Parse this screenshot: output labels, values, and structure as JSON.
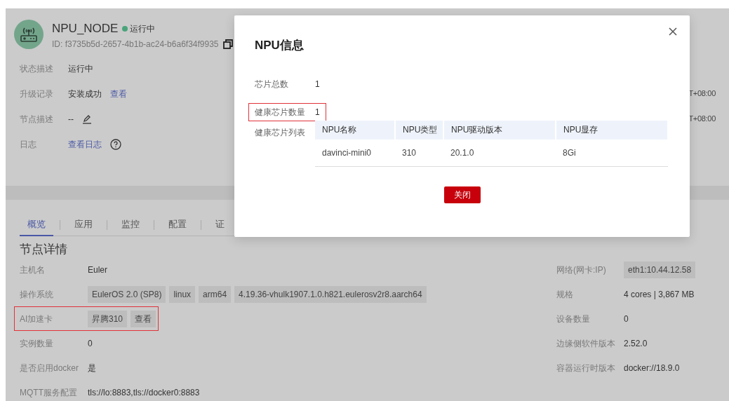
{
  "node": {
    "name": "NPU_NODE",
    "status": "运行中",
    "id": "ID: f3735b5d-2657-4b1b-ac24-b6a6f34f9935"
  },
  "info_rows": [
    {
      "label": "状态描述",
      "values": [
        {
          "kind": "text",
          "text": "运行中"
        }
      ]
    },
    {
      "label": "升级记录",
      "values": [
        {
          "kind": "text",
          "text": "安装成功"
        },
        {
          "kind": "link",
          "text": "查看"
        }
      ],
      "time": "T+08:00"
    },
    {
      "label": "节点描述",
      "values": [
        {
          "kind": "text",
          "text": "--"
        },
        {
          "kind": "edit"
        }
      ],
      "time": "T+08:00"
    },
    {
      "label": "日志",
      "values": [
        {
          "kind": "link",
          "text": "查看日志"
        },
        {
          "kind": "help"
        }
      ]
    }
  ],
  "tabs": [
    {
      "label": "概览",
      "selected": true
    },
    {
      "label": "应用",
      "selected": false
    },
    {
      "label": "监控",
      "selected": false
    },
    {
      "label": "配置",
      "selected": false
    },
    {
      "label": "证",
      "selected": false
    }
  ],
  "section_title": "节点详情",
  "details_left": [
    {
      "label": "主机名",
      "highlighted": false,
      "values": [
        {
          "kind": "text",
          "text": "Euler"
        }
      ]
    },
    {
      "label": "操作系统",
      "highlighted": false,
      "values": [
        {
          "kind": "tag",
          "text": "EulerOS 2.0 (SP8)"
        },
        {
          "kind": "tag",
          "text": "linux"
        },
        {
          "kind": "tag",
          "text": "arm64"
        },
        {
          "kind": "tag",
          "text": "4.19.36-vhulk1907.1.0.h821.eulerosv2r8.aarch64"
        }
      ]
    },
    {
      "label": "AI加速卡",
      "highlighted": true,
      "values": [
        {
          "kind": "tag",
          "text": "昇腾310"
        },
        {
          "kind": "taglink",
          "text": "查看"
        }
      ]
    },
    {
      "label": "实例数量",
      "highlighted": false,
      "values": [
        {
          "kind": "text",
          "text": "0"
        }
      ]
    },
    {
      "label": "是否启用docker",
      "highlighted": false,
      "values": [
        {
          "kind": "text",
          "text": "是"
        }
      ]
    },
    {
      "label": "MQTT服务配置",
      "highlighted": false,
      "values": [
        {
          "kind": "text",
          "text": "tls://lo:8883,tls://docker0:8883"
        }
      ]
    }
  ],
  "details_right": [
    {
      "label": "网络(网卡:IP)",
      "highlighted": false,
      "values": [
        {
          "kind": "tag",
          "text": "eth1:10.44.12.58"
        }
      ]
    },
    {
      "label": "规格",
      "highlighted": false,
      "values": [
        {
          "kind": "text",
          "text": "4 cores | 3,867 MB"
        }
      ]
    },
    {
      "label": "设备数量",
      "highlighted": false,
      "values": [
        {
          "kind": "text",
          "text": "0"
        }
      ]
    },
    {
      "label": "边缘侧软件版本",
      "highlighted": false,
      "values": [
        {
          "kind": "text",
          "text": "2.52.0"
        }
      ]
    },
    {
      "label": "容器运行时版本",
      "highlighted": false,
      "values": [
        {
          "kind": "text",
          "text": "docker://18.9.0"
        }
      ]
    }
  ],
  "modal": {
    "title": "NPU信息",
    "rows": [
      {
        "label": "芯片总数",
        "value": "1",
        "highlighted": false
      },
      {
        "label": "健康芯片数量",
        "value": "1",
        "highlighted": true
      }
    ],
    "table_label": "健康芯片列表",
    "table": {
      "columns": [
        "NPU名称",
        "NPU类型",
        "NPU驱动版本",
        "NPU显存"
      ],
      "rows": [
        [
          "davinci-mini0",
          "310",
          "20.1.0",
          "8Gi"
        ]
      ]
    },
    "button": "关闭"
  }
}
